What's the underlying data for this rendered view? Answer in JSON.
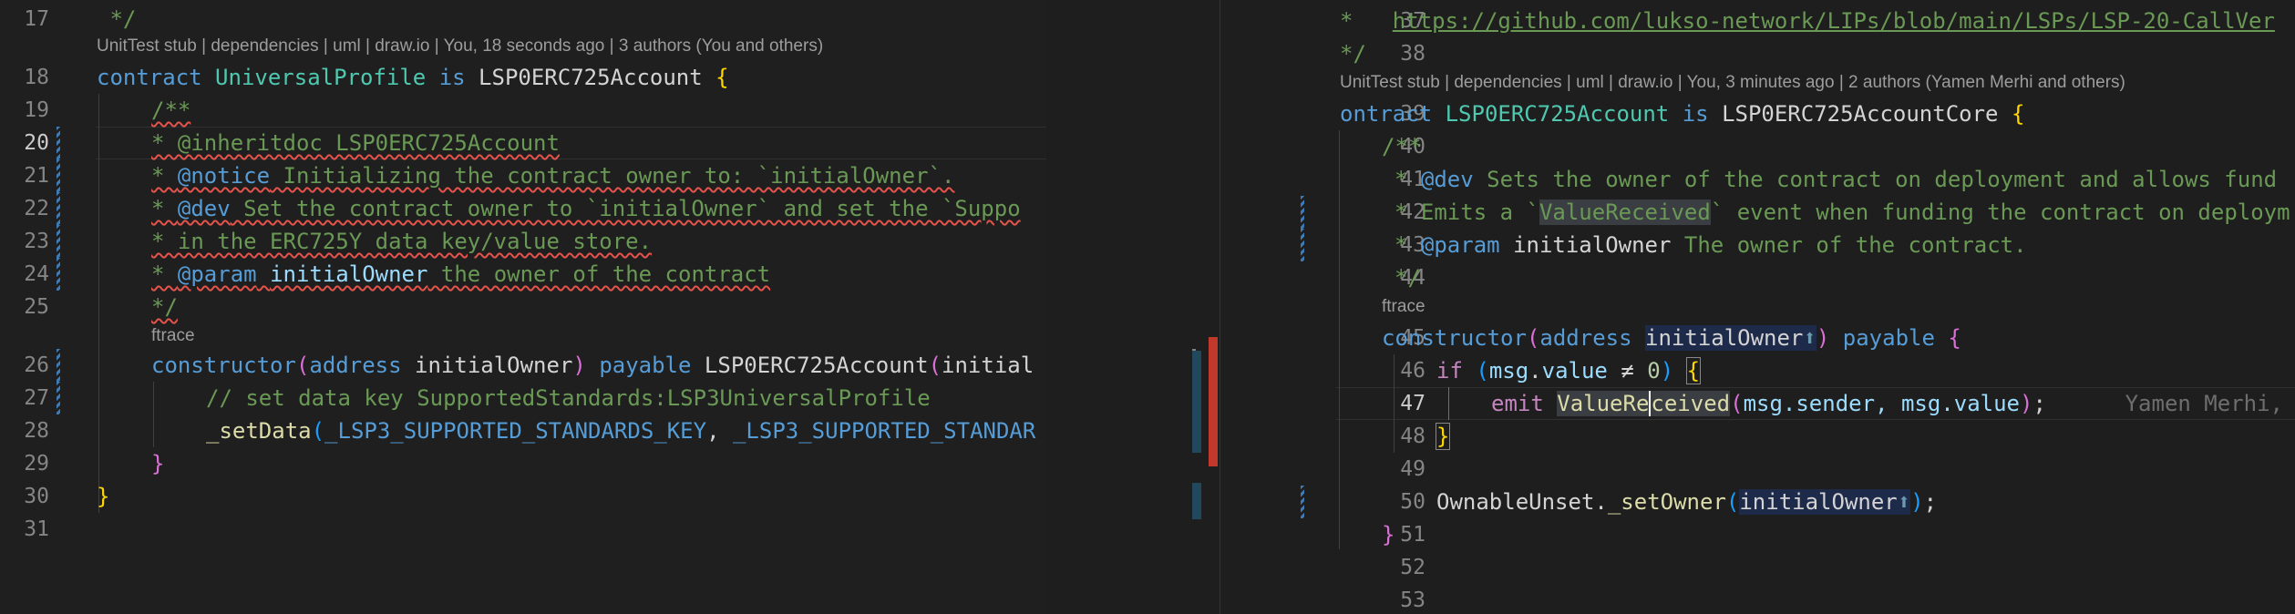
{
  "left": {
    "codelens_top": "UnitTest stub | dependencies | uml | draw.io | You, 18 seconds ago | 3 authors (You and others)",
    "codelens_ftrace": "ftrace",
    "lines": [
      {
        "n": "17"
      },
      {
        "n": "18"
      },
      {
        "n": "19"
      },
      {
        "n": "20"
      },
      {
        "n": "21"
      },
      {
        "n": "22"
      },
      {
        "n": "23"
      },
      {
        "n": "24"
      },
      {
        "n": "25"
      },
      {
        "n": "26"
      },
      {
        "n": "27"
      },
      {
        "n": "28"
      },
      {
        "n": "29"
      },
      {
        "n": "30"
      },
      {
        "n": "31"
      }
    ],
    "code": {
      "l17": " */",
      "l18_kw": "contract",
      "l18_name": "UniversalProfile",
      "l18_is": "is",
      "l18_base": "LSP0ERC725Account",
      "l18_brace": "{",
      "l19": "/**",
      "l20": "* @inheritdoc LSP0ERC725Account",
      "l21_tag": "@notice",
      "l21_text": " Initializing the contract owner to: `initialOwner`.",
      "l22_tag": "@dev",
      "l22_text": " Set the contract owner to `initialOwner` and set the `Suppo",
      "l23": "* in the ERC725Y data key/value store.",
      "l24_tag": "@param",
      "l24_param": "initialOwner",
      "l24_text": " the owner of the contract",
      "l25": "*/",
      "l26_fn": "constructor",
      "l26_type": "address",
      "l26_param": "initialOwner",
      "l26_payable": "payable",
      "l26_call": "LSP0ERC725Account",
      "l26_rest": "initial",
      "l27": "// set data key SupportedStandards:LSP3UniversalProfile",
      "l28_fn": "_setData",
      "l28_a1": "_LSP3_SUPPORTED_STANDARDS_KEY",
      "l28_a2": "_LSP3_SUPPORTED_STANDAR",
      "l29": "}",
      "l30": "}"
    }
  },
  "right": {
    "codelens_top": "UnitTest stub | dependencies | uml | draw.io | You, 3 minutes ago | 2 authors (Yamen Merhi and others)",
    "codelens_ftrace": "ftrace",
    "lines": [
      {
        "n": "37"
      },
      {
        "n": "38"
      },
      {
        "n": "39"
      },
      {
        "n": "40"
      },
      {
        "n": "41"
      },
      {
        "n": "42"
      },
      {
        "n": "43"
      },
      {
        "n": "44"
      },
      {
        "n": "45"
      },
      {
        "n": "46"
      },
      {
        "n": "47"
      },
      {
        "n": "48"
      },
      {
        "n": "49"
      },
      {
        "n": "50"
      },
      {
        "n": "51"
      },
      {
        "n": "52"
      },
      {
        "n": "53"
      }
    ],
    "code": {
      "l37_star": "*   ",
      "l37_link": "https://github.com/lukso-network/LIPs/blob/main/LSPs/LSP-20-CallVer",
      "l38": "*/",
      "l39_kw": "ontract",
      "l39_name": "LSP0ERC725Account",
      "l39_is": "is",
      "l39_base": "LSP0ERC725AccountCore",
      "l39_brace": "{",
      "l40": "/**",
      "l41_tag": "@dev",
      "l41_text": " Sets the owner of the contract on deployment and allows fund",
      "l42_a": "* Emits a `",
      "l42_word": "ValueReceived",
      "l42_b": "` event when funding the contract on deploym",
      "l43_tag": "@param",
      "l43_param": "initialOwner",
      "l43_text": " The owner of the contract.",
      "l44": "*/",
      "l45_fn": "constructor",
      "l45_type": "address",
      "l45_param": "initialOwner",
      "l45_arrow": "⬆",
      "l45_payable": "payable",
      "l45_brace": "{",
      "l46_if": "if",
      "l46_msg": "msg",
      "l46_value": "value",
      "l46_neq": "≠",
      "l46_zero": "0",
      "l46_brace": "{",
      "l47_emit": "emit",
      "l47_event_a": "ValueRe",
      "l47_event_b": "ceived",
      "l47_args": "msg.sender, msg.value",
      "l47_blame": "Yamen Merhi,",
      "l48": "}",
      "l50_obj": "OwnableUnset",
      "l50_fn": "_setOwner",
      "l50_param": "initialOwner",
      "l50_arrow": "⬆",
      "l51": "}"
    }
  },
  "colors": {
    "background": "#1f1f1f",
    "keyword": "#569cd6",
    "type": "#4ec9b0",
    "function": "#dcdcaa",
    "comment": "#6a9955",
    "error_squiggle": "#e5534b",
    "deleted_marker": "#c0392b",
    "modified_marker": "#3c7bb5"
  }
}
